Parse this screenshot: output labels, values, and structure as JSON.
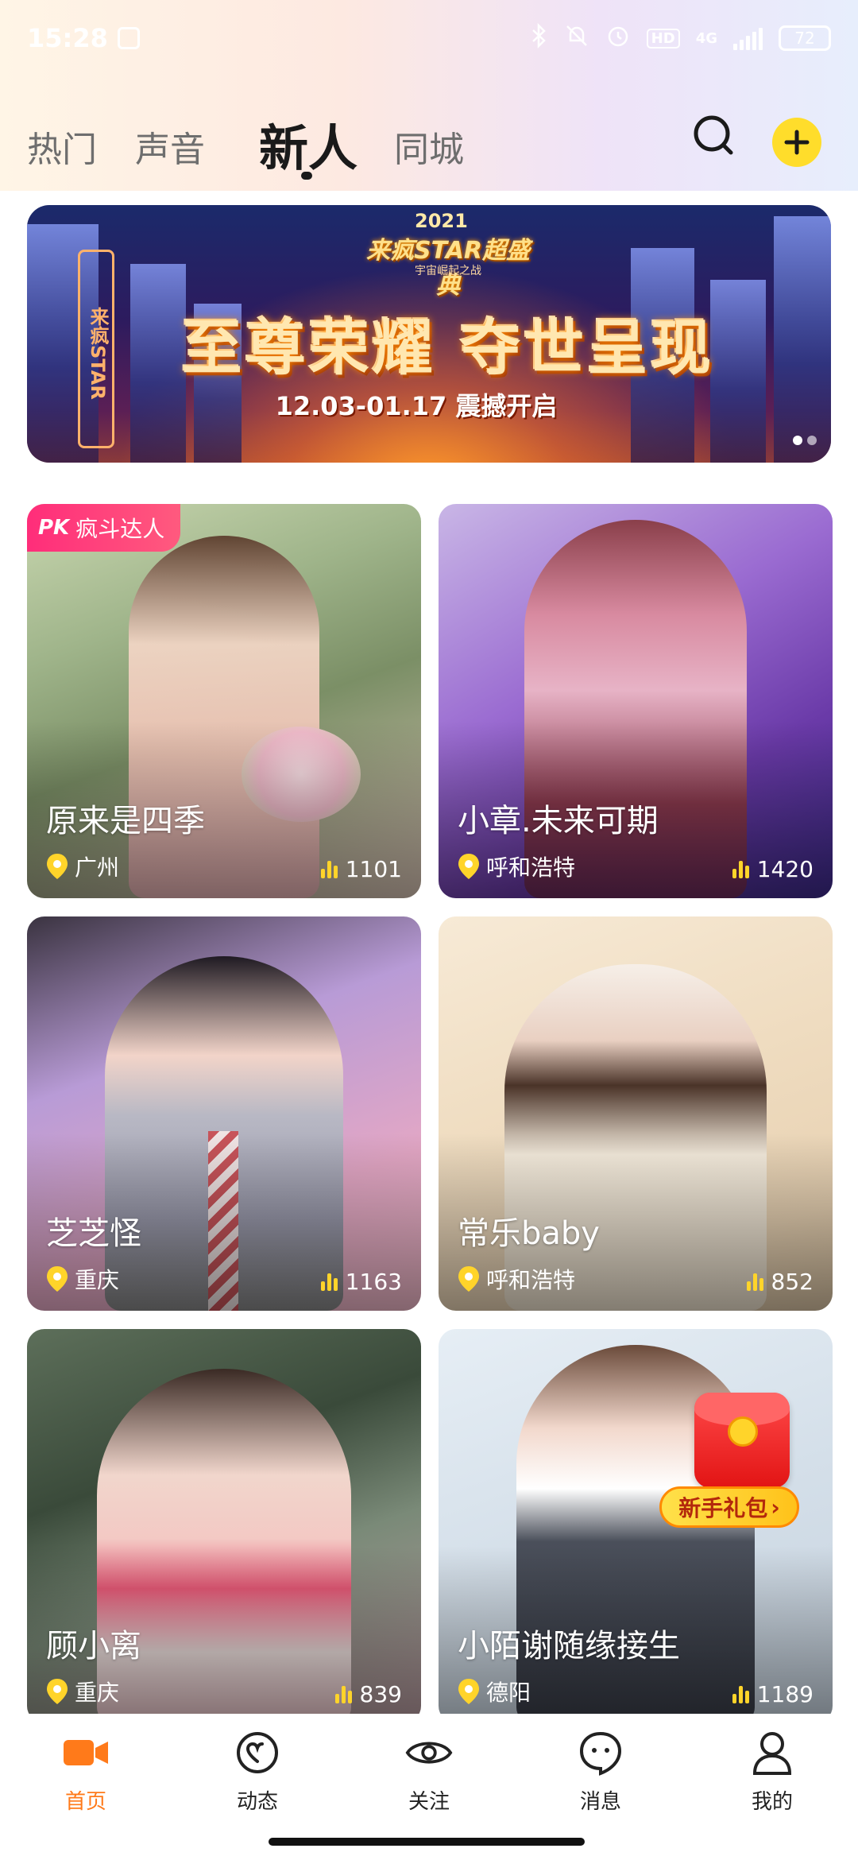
{
  "status_bar": {
    "time": "15:28",
    "network": "4G",
    "battery": "72",
    "hd_badge": "HD",
    "icons": [
      "bluetooth-icon",
      "mute-icon",
      "alarm-icon",
      "hd-icon",
      "signal-icon",
      "battery-icon"
    ]
  },
  "tabs": [
    {
      "label": "热门",
      "active": false
    },
    {
      "label": "声音",
      "active": false
    },
    {
      "label": "新人",
      "active": true
    },
    {
      "label": "同城",
      "active": false
    }
  ],
  "header_icons": {
    "search": "search-icon",
    "add": "plus-icon"
  },
  "banner": {
    "year": "2021",
    "event": "来疯STAR超盛典",
    "subtitle": "宇宙崛起之战",
    "title": "至尊荣耀 夺世呈现",
    "date_line": "12.03-01.17 震撼开启",
    "side_text": "来疯STAR",
    "page_count": 2,
    "current_page": 1
  },
  "cards": [
    {
      "name": "原来是四季",
      "location": "广州",
      "popularity": "1101",
      "badge": "疯斗达人",
      "badge_logo": "PK"
    },
    {
      "name": "小章.未来可期",
      "location": "呼和浩特",
      "popularity": "1420"
    },
    {
      "name": "芝芝怪",
      "location": "重庆",
      "popularity": "1163"
    },
    {
      "name": "常乐baby",
      "location": "呼和浩特",
      "popularity": "852"
    },
    {
      "name": "顾小离",
      "location": "重庆",
      "popularity": "839"
    },
    {
      "name": "小陌谢随缘接生",
      "location": "德阳",
      "popularity": "1189"
    }
  ],
  "gift": {
    "label": "新手礼包",
    "arrow": "›"
  },
  "bottom_nav": [
    {
      "label": "首页",
      "icon": "video-camera-icon",
      "active": true
    },
    {
      "label": "动态",
      "icon": "heart-circle-icon",
      "active": false
    },
    {
      "label": "关注",
      "icon": "eye-icon",
      "active": false
    },
    {
      "label": "消息",
      "icon": "chat-bubble-icon",
      "active": false
    },
    {
      "label": "我的",
      "icon": "person-icon",
      "active": false
    }
  ],
  "colors": {
    "accent_yellow": "#ffdd2b",
    "active_orange": "#ff7a1a",
    "badge_pink": "#ff2d7a",
    "popularity_bars": "#ffd42a"
  }
}
